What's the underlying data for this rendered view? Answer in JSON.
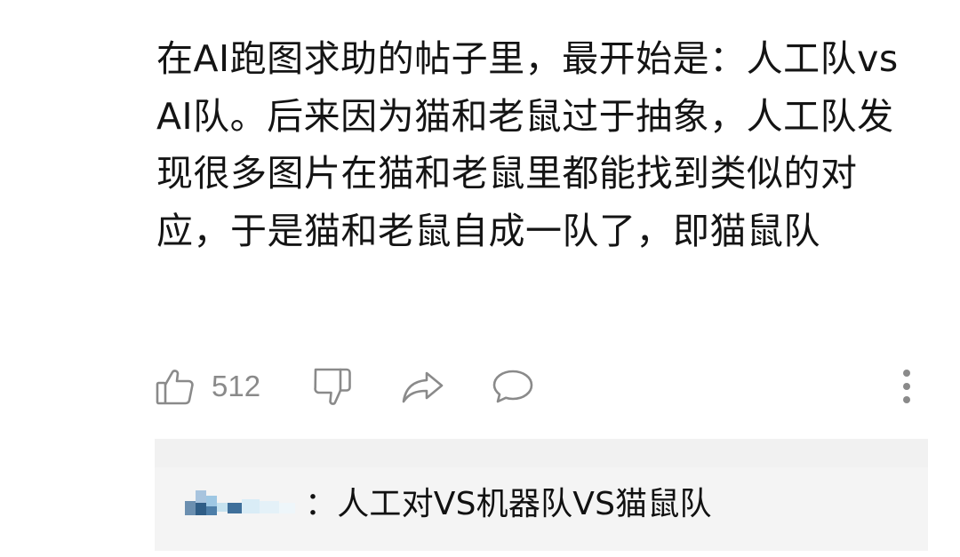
{
  "comment": {
    "text": "在AI跑图求助的帖子里，最开始是：人工队vs AI队。后来因为猫和老鼠过于抽象，人工队发现很多图片在猫和老鼠里都能找到类似的对应，于是猫和老鼠自成一队了，即猫鼠队"
  },
  "actions": {
    "like_icon": "thumbs-up-icon",
    "like_count": "512",
    "dislike_icon": "thumbs-down-icon",
    "share_icon": "share-arrow-icon",
    "reply_icon": "comment-bubble-icon",
    "more_icon": "vertical-dots-icon",
    "icon_color": "#8a8a8a"
  },
  "sub_reply": {
    "author_censored": true,
    "text": "：人工对VS机器队VS猫鼠队"
  }
}
